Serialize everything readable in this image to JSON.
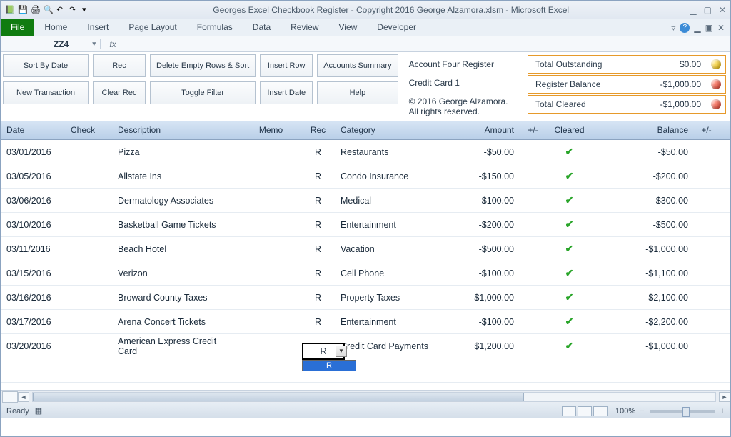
{
  "window": {
    "title": "Georges Excel Checkbook Register - Copyright 2016 George Alzamora.xlsm  -  Microsoft Excel"
  },
  "ribbon": {
    "tabs": [
      "File",
      "Home",
      "Insert",
      "Page Layout",
      "Formulas",
      "Data",
      "Review",
      "View",
      "Developer"
    ]
  },
  "namebox": "ZZ4",
  "toolbar": {
    "sort_by_date": "Sort By Date",
    "rec": "Rec",
    "delete_empty": "Delete Empty Rows & Sort",
    "insert_row": "Insert Row",
    "accounts_summary": "Accounts Summary",
    "new_transaction": "New Transaction",
    "clear_rec": "Clear Rec",
    "toggle_filter": "Toggle Filter",
    "insert_date": "Insert Date",
    "help": "Help"
  },
  "info": {
    "line1": "Account Four Register",
    "line2": "Credit Card 1",
    "line3": "© 2016 George Alzamora.  All rights reserved."
  },
  "summary": [
    {
      "label": "Total Outstanding",
      "value": "$0.00",
      "dot": "yellow"
    },
    {
      "label": "Register Balance",
      "value": "-$1,000.00",
      "dot": "red"
    },
    {
      "label": "Total Cleared",
      "value": "-$1,000.00",
      "dot": "red"
    }
  ],
  "columns": {
    "date": "Date",
    "check": "Check",
    "desc": "Description",
    "memo": "Memo",
    "rec": "Rec",
    "cat": "Category",
    "amt": "Amount",
    "pm": "+/-",
    "clr": "Cleared",
    "bal": "Balance",
    "pm2": "+/-"
  },
  "rows": [
    {
      "date": "03/01/2016",
      "check": "",
      "desc": "Pizza",
      "memo": "",
      "rec": "R",
      "cat": "Restaurants",
      "amt": "-$50.00",
      "pm": "red",
      "clr": true,
      "bal": "-$50.00",
      "pm2": "red"
    },
    {
      "date": "03/05/2016",
      "check": "",
      "desc": "Allstate Ins",
      "memo": "",
      "rec": "R",
      "cat": "Condo Insurance",
      "amt": "-$150.00",
      "pm": "red",
      "clr": true,
      "bal": "-$200.00",
      "pm2": "red"
    },
    {
      "date": "03/06/2016",
      "check": "",
      "desc": "Dermatology Associates",
      "memo": "",
      "rec": "R",
      "cat": "Medical",
      "amt": "-$100.00",
      "pm": "red",
      "clr": true,
      "bal": "-$300.00",
      "pm2": "red"
    },
    {
      "date": "03/10/2016",
      "check": "",
      "desc": "Basketball Game Tickets",
      "memo": "",
      "rec": "R",
      "cat": "Entertainment",
      "amt": "-$200.00",
      "pm": "red",
      "clr": true,
      "bal": "-$500.00",
      "pm2": "red"
    },
    {
      "date": "03/11/2016",
      "check": "",
      "desc": "Beach Hotel",
      "memo": "",
      "rec": "R",
      "cat": "Vacation",
      "amt": "-$500.00",
      "pm": "red",
      "clr": true,
      "bal": "-$1,000.00",
      "pm2": "red"
    },
    {
      "date": "03/15/2016",
      "check": "",
      "desc": "Verizon",
      "memo": "",
      "rec": "R",
      "cat": "Cell Phone",
      "amt": "-$100.00",
      "pm": "red",
      "clr": true,
      "bal": "-$1,100.00",
      "pm2": "red"
    },
    {
      "date": "03/16/2016",
      "check": "",
      "desc": "Broward County Taxes",
      "memo": "",
      "rec": "R",
      "cat": "Property Taxes",
      "amt": "-$1,000.00",
      "pm": "red",
      "clr": true,
      "bal": "-$2,100.00",
      "pm2": "red"
    },
    {
      "date": "03/17/2016",
      "check": "",
      "desc": "Arena Concert Tickets",
      "memo": "",
      "rec": "R",
      "cat": "Entertainment",
      "amt": "-$100.00",
      "pm": "red",
      "clr": true,
      "bal": "-$2,200.00",
      "pm2": "red"
    },
    {
      "date": "03/20/2016",
      "check": "",
      "desc": "American Express Credit Card",
      "memo": "",
      "rec": "R",
      "cat": "Credit Card Payments",
      "amt": "$1,200.00",
      "pm": "green",
      "clr": true,
      "bal": "-$1,000.00",
      "pm2": "red",
      "dropdown": true
    }
  ],
  "dropdown_option": "R",
  "status": {
    "ready": "Ready",
    "zoom": "100%"
  }
}
